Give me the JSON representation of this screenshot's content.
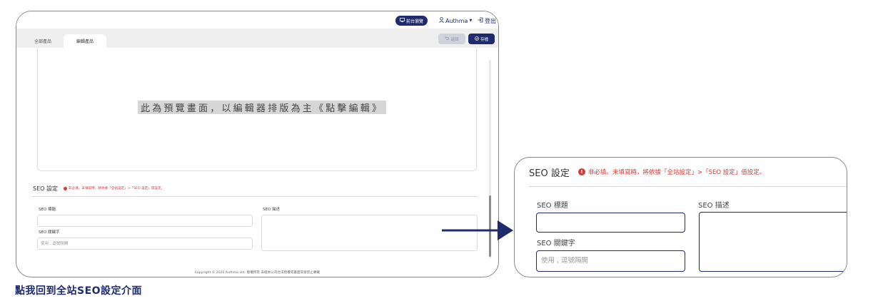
{
  "header": {
    "backend_label": "前台瀏覽",
    "user_label": "Authma",
    "logout_label": "登出"
  },
  "tabs": [
    {
      "label": "全部產品"
    },
    {
      "label": "編輯產品"
    }
  ],
  "actions": {
    "back_label": "返回",
    "save_label": "存檔"
  },
  "preview": {
    "text": "此為預覽畫面，以編輯器排版為主《點擊編輯》"
  },
  "seo": {
    "title": "SEO 設定",
    "note": "非必填。未填寫時，將依據「全站設定」>「SEO 設定」值設定。",
    "seo_title_label": "SEO 標題",
    "seo_desc_label": "SEO 描述",
    "seo_keywords_label": "SEO 關鍵字",
    "seo_keywords_placeholder": "使用 , 逗號隔開"
  },
  "footer": {
    "copyright": "Copyright © 2020 Authma Ltd. 版權所有 未經本公司合法授權或書面同意禁止轉載"
  },
  "caption": "點我回到全站SEO設定介面",
  "colors": {
    "brand": "#1f2b6c",
    "warning": "#d13b3b"
  }
}
